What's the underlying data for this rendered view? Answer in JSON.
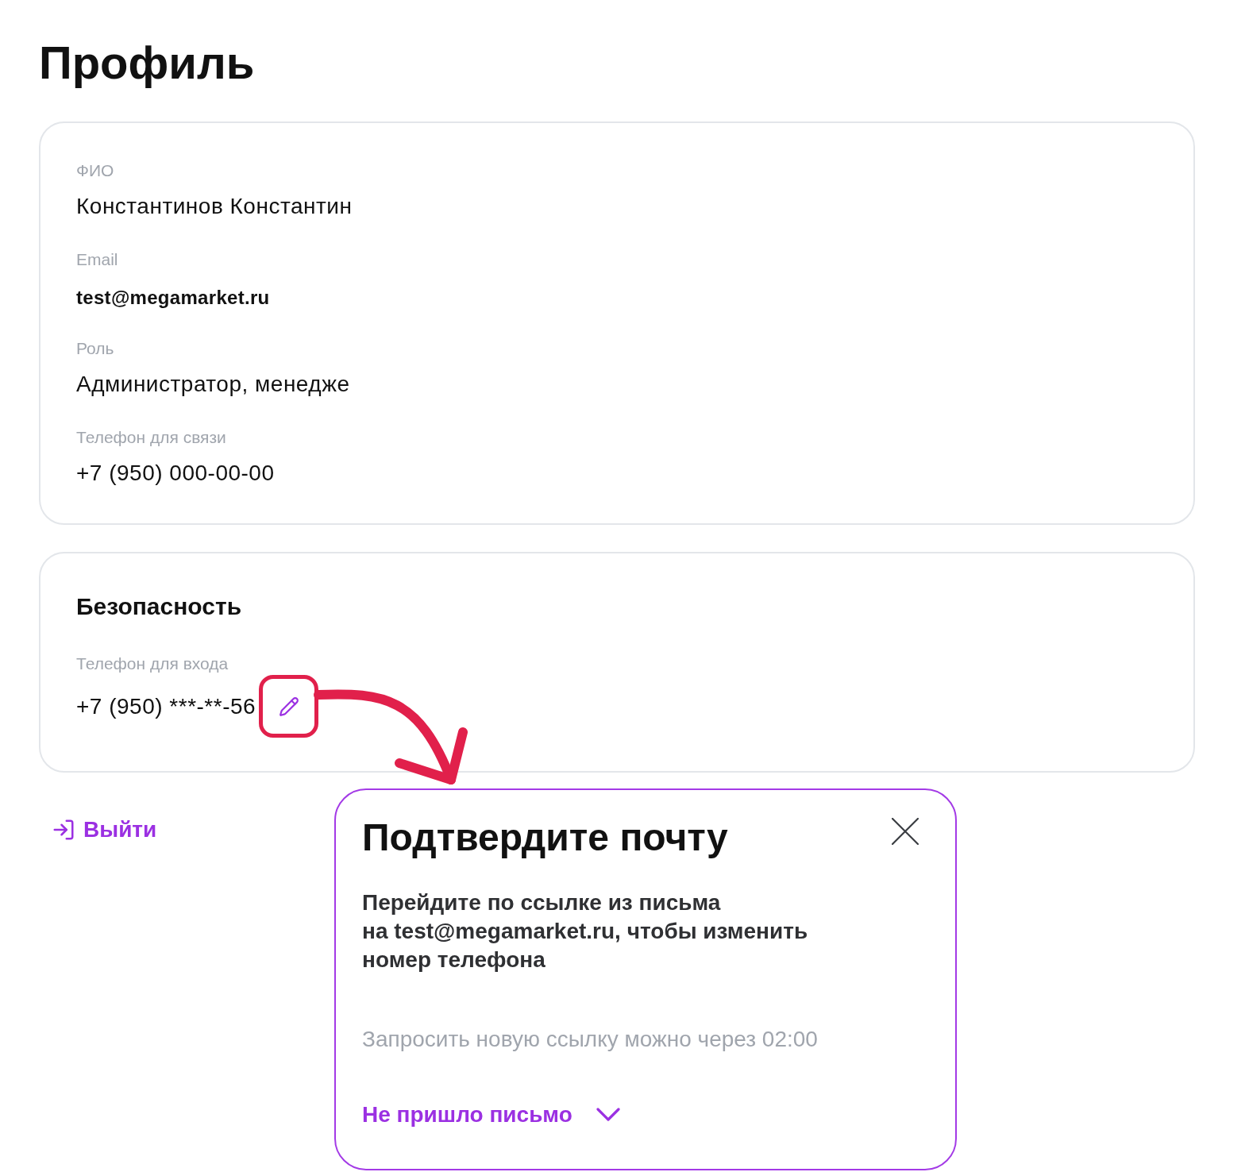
{
  "page": {
    "title": "Профиль"
  },
  "profile_card": {
    "fields": [
      {
        "label": "ФИО",
        "value": "Константинов Константин",
        "kind": "text"
      },
      {
        "label": "Email",
        "value": "test@megamarket.ru",
        "kind": "email"
      },
      {
        "label": "Роль",
        "value": "Администратор, менедже",
        "kind": "text"
      },
      {
        "label": "Телефон для связи",
        "value": "+7 (950) 000-00-00",
        "kind": "text"
      }
    ]
  },
  "security_card": {
    "title": "Безопасность",
    "login_phone": {
      "label": "Телефон для входа",
      "value": "+7 (950) ***-**-56"
    }
  },
  "logout_link": {
    "label": "Выйти"
  },
  "modal": {
    "title": "Подтвердите почту",
    "message": "Перейдите по ссылке из письма\nна test@megamarket.ru, чтобы изменить\nномер телефона",
    "timer_note": "Запросить новую ссылку можно через 02:00",
    "toggle": {
      "label": "Не пришло письмо",
      "expanded": false
    }
  }
}
